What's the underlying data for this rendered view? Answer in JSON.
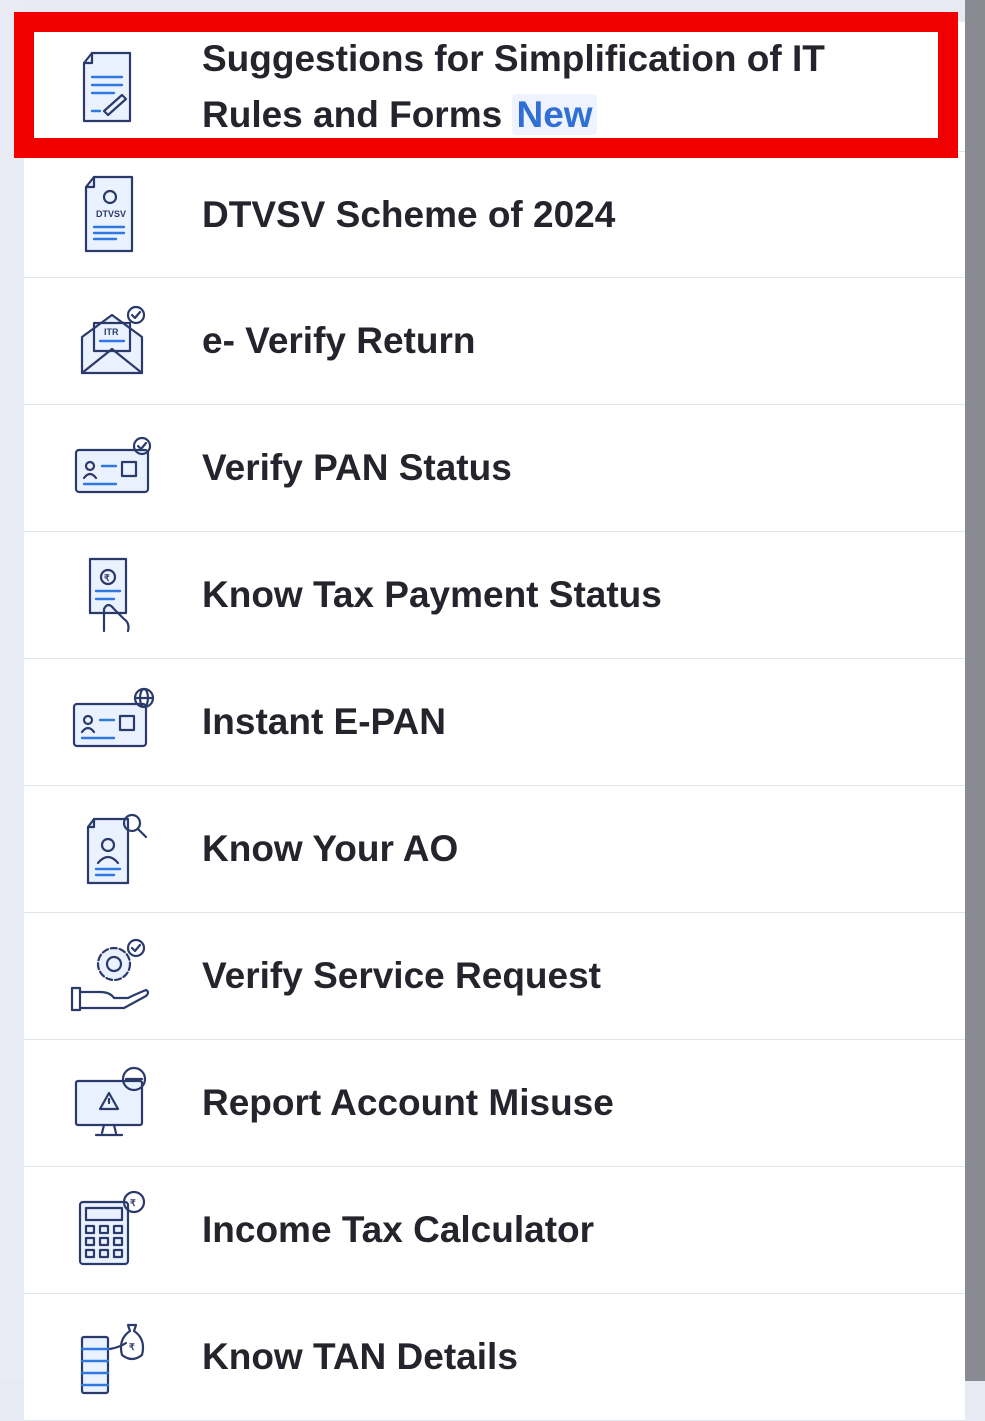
{
  "menu": {
    "items": [
      {
        "label": "Suggestions for Simplification of IT Rules and Forms",
        "badge": "New",
        "icon": "document-pen-icon"
      },
      {
        "label": "DTVSV Scheme of 2024",
        "icon": "dtvsv-document-icon"
      },
      {
        "label": "e- Verify Return",
        "icon": "envelope-check-icon"
      },
      {
        "label": "Verify PAN Status",
        "icon": "pan-card-check-icon"
      },
      {
        "label": "Know Tax Payment Status",
        "icon": "receipt-hand-icon"
      },
      {
        "label": "Instant E-PAN",
        "icon": "pan-card-globe-icon"
      },
      {
        "label": "Know Your AO",
        "icon": "profile-search-icon"
      },
      {
        "label": "Verify Service Request",
        "icon": "gear-hand-check-icon"
      },
      {
        "label": "Report Account Misuse",
        "icon": "monitor-warning-icon"
      },
      {
        "label": "Income Tax Calculator",
        "icon": "calculator-rupee-icon"
      },
      {
        "label": "Know TAN Details",
        "icon": "coins-rupee-bag-icon"
      }
    ]
  },
  "icon_text": {
    "dtvsv": "DTVSV",
    "itr": "ITR",
    "rupee": "₹"
  },
  "colors": {
    "accent": "#2f6fd6",
    "highlight": "#f20000",
    "text": "#23242c"
  }
}
